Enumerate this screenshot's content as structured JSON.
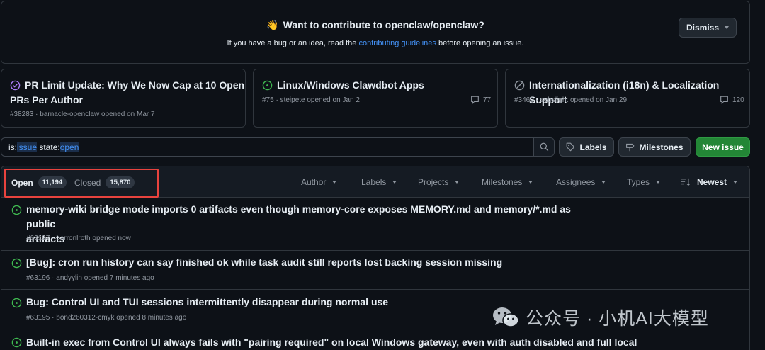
{
  "banner": {
    "emoji": "👋",
    "title": "Want to contribute to openclaw/openclaw?",
    "subtitle_before": "If you have a bug or an idea, read the ",
    "subtitle_link": "contributing guidelines",
    "subtitle_after": " before opening an issue.",
    "dismiss_label": "Dismiss"
  },
  "pinned": [
    {
      "title_line1": "PR Limit Update: Why We Now Cap at 10 Open",
      "title_line2": "PRs Per Author",
      "meta": "#38283 · barnacle-openclaw opened on Mar 7",
      "comments": "",
      "icon": "issue-closed-completed-icon"
    },
    {
      "title_line1": "Linux/Windows Clawdbot Apps",
      "title_line2": "",
      "meta": "#75 · steipete opened on Jan 2",
      "comments": "77",
      "icon": "issue-open-icon"
    },
    {
      "title_line1": "Internationalization (i18n) & Localization Support",
      "title_line2": "",
      "meta": "#3460 · sebslight opened on Jan 29",
      "comments": "120",
      "icon": "issue-closed-not-planned-icon"
    }
  ],
  "search": {
    "prefix1": "is:",
    "term1": "issue",
    "middle": " state:",
    "term2": "open"
  },
  "toolbar": {
    "labels": "Labels",
    "milestones": "Milestones",
    "new_issue": "New issue"
  },
  "states": {
    "open_label": "Open",
    "open_count": "11,194",
    "closed_label": "Closed",
    "closed_count": "15,870"
  },
  "filters": {
    "author": "Author",
    "labels": "Labels",
    "projects": "Projects",
    "milestones": "Milestones",
    "assignees": "Assignees",
    "types": "Types",
    "sort": "Newest"
  },
  "issues": [
    {
      "title_line1": "memory-wiki bridge mode imports 0 artifacts even though memory-core exposes MEMORY.md and memory/*.md as public",
      "title_line2": "artifacts",
      "meta": "#63197 · barronlroth opened now"
    },
    {
      "title_line1": "[Bug]: cron run history can say finished ok while task audit still reports lost backing session missing",
      "title_line2": "",
      "meta": "#63196 · andyylin opened 7 minutes ago"
    },
    {
      "title_line1": "Bug: Control UI and TUI sessions intermittently disappear during normal use",
      "title_line2": "",
      "meta": "#63195 · bond260312-cmyk opened 8 minutes ago"
    },
    {
      "title_line1": "Built-in exec from Control UI always fails with \"pairing required\" on local Windows gateway, even with auth disabled and full local",
      "title_line2": "",
      "meta": ""
    }
  ],
  "watermark": {
    "text": "公众号 · 小机AI大模型"
  },
  "colors": {
    "accent_link": "#4493f8",
    "open_green": "#3fb950",
    "done_purple": "#ab7df8",
    "button_green": "#238636",
    "highlight_red": "#e8433e"
  }
}
